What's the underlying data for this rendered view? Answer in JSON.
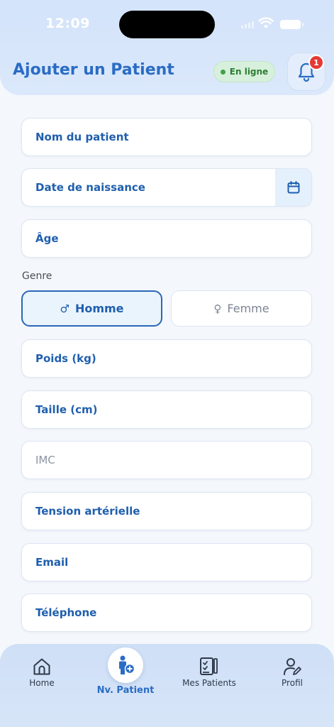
{
  "status_bar": {
    "time": "12:09"
  },
  "header": {
    "title": "Ajouter un Patient",
    "online_badge": "En ligne",
    "notification_count": "1"
  },
  "form": {
    "fields": [
      {
        "label": "Nom du patient"
      },
      {
        "label": "Date de naissance"
      },
      {
        "label": "Âge"
      }
    ],
    "gender_section_label": "Genre",
    "gender_options": [
      {
        "label": "Homme",
        "selected": true
      },
      {
        "label": "Femme",
        "selected": false
      }
    ],
    "fields_2": [
      {
        "label": "Poids (kg)"
      },
      {
        "label": "Taille (cm)"
      },
      {
        "label": "IMC"
      },
      {
        "label": "Tension artérielle"
      },
      {
        "label": "Email"
      },
      {
        "label": "Téléphone"
      }
    ]
  },
  "bottom_nav": {
    "items": [
      {
        "label": "Home",
        "icon": "home-icon"
      },
      {
        "label": "Nv. Patient",
        "icon": "add-patient-icon",
        "active": true
      },
      {
        "label": "Mes Patients",
        "icon": "clipboard-icon"
      },
      {
        "label": "Profil",
        "icon": "profile-edit-icon"
      }
    ]
  },
  "colors": {
    "primary": "#2a6cc4",
    "header_bg": "#d3e3fa",
    "online_green": "#43a047",
    "badge_red": "#e53935"
  }
}
